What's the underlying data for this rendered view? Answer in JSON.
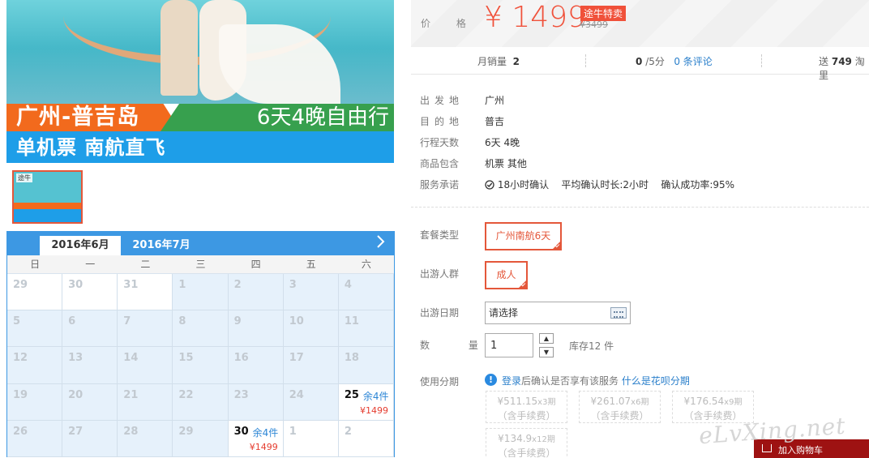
{
  "banner": {
    "title_left": "广州-普吉岛",
    "title_right": "6天4晚自由行",
    "subtitle": "单机票  南航直飞"
  },
  "thumbnail": {
    "logo_text": "途牛"
  },
  "calendar": {
    "tabs": [
      "2016年6月",
      "2016年7月"
    ],
    "next_icon": "chevron-right-icon",
    "weekdays": [
      "日",
      "一",
      "二",
      "三",
      "四",
      "五",
      "六"
    ],
    "weeks": [
      [
        {
          "d": "29"
        },
        {
          "d": "30"
        },
        {
          "d": "31"
        },
        {
          "d": "1"
        },
        {
          "d": "2"
        },
        {
          "d": "3"
        },
        {
          "d": "4"
        }
      ],
      [
        {
          "d": "5"
        },
        {
          "d": "6"
        },
        {
          "d": "7"
        },
        {
          "d": "8"
        },
        {
          "d": "9"
        },
        {
          "d": "10"
        },
        {
          "d": "11"
        }
      ],
      [
        {
          "d": "12"
        },
        {
          "d": "13"
        },
        {
          "d": "14"
        },
        {
          "d": "15"
        },
        {
          "d": "16"
        },
        {
          "d": "17"
        },
        {
          "d": "18"
        }
      ],
      [
        {
          "d": "19"
        },
        {
          "d": "20"
        },
        {
          "d": "21"
        },
        {
          "d": "22"
        },
        {
          "d": "23"
        },
        {
          "d": "24"
        },
        {
          "d": "25",
          "stock": "余4件",
          "price": "¥1499"
        }
      ],
      [
        {
          "d": "26"
        },
        {
          "d": "27"
        },
        {
          "d": "28"
        },
        {
          "d": "29"
        },
        {
          "d": "30",
          "stock": "余4件",
          "price": "¥1499"
        },
        {
          "d": "1"
        },
        {
          "d": "2"
        }
      ]
    ]
  },
  "price": {
    "label": "价 格",
    "value": "¥ 1499",
    "badge": "途牛特卖",
    "original": "¥3499"
  },
  "stats": {
    "monthly_sales_label": "月销量",
    "monthly_sales": "2",
    "rating": "0",
    "rating_suffix": "/5分",
    "reviews_count": "0",
    "reviews_label": "条评论",
    "gift_prefix": "送",
    "gift_value": "749",
    "gift_suffix": "淘里"
  },
  "info": {
    "departure_label": "出发地",
    "departure": "广州",
    "destination_label": "目的地",
    "destination": "普吉",
    "days_label": "行程天数",
    "days": "6天 4晚",
    "includes_label": "商品包含",
    "includes": "机票  其他",
    "service_label": "服务承诺",
    "service_icon": "check-circle-icon",
    "service_confirm": "18小时确认",
    "service_avg": "平均确认时长:2小时",
    "service_rate": "确认成功率:95%"
  },
  "options": {
    "package_label": "套餐类型",
    "package_value": "广州南航6天",
    "travelers_label": "出游人群",
    "travelers_value": "成人",
    "date_label": "出游日期",
    "date_placeholder": "请选择",
    "date_icon": "calendar-icon",
    "qty_label": "数 量",
    "qty_value": "1",
    "qty_up_icon": "caret-up-icon",
    "qty_down_icon": "caret-down-icon",
    "stock_text": "库存12 件"
  },
  "installment": {
    "label": "使用分期",
    "info_icon": "info-icon",
    "login_link": "登录",
    "text": "后确认是否享有该服务",
    "what_link": "什么是花呗分期",
    "plans": [
      {
        "amount": "¥511.15",
        "periods": "x3期",
        "fee": "（含手续费）"
      },
      {
        "amount": "¥261.07",
        "periods": "x6期",
        "fee": "（含手续费）"
      },
      {
        "amount": "¥176.54",
        "periods": "x9期",
        "fee": "（含手续费）"
      },
      {
        "amount": "¥134.9",
        "periods": "x12期",
        "fee": "（含手续费）"
      }
    ]
  },
  "watermark": "eLvXing.net",
  "cart": {
    "label": "加入购物车",
    "icon": "cart-icon"
  },
  "colors": {
    "accent": "#f0513a",
    "link": "#2a7fcb",
    "calendar_blue": "#3d98e3",
    "cart_red": "#9e1212"
  }
}
